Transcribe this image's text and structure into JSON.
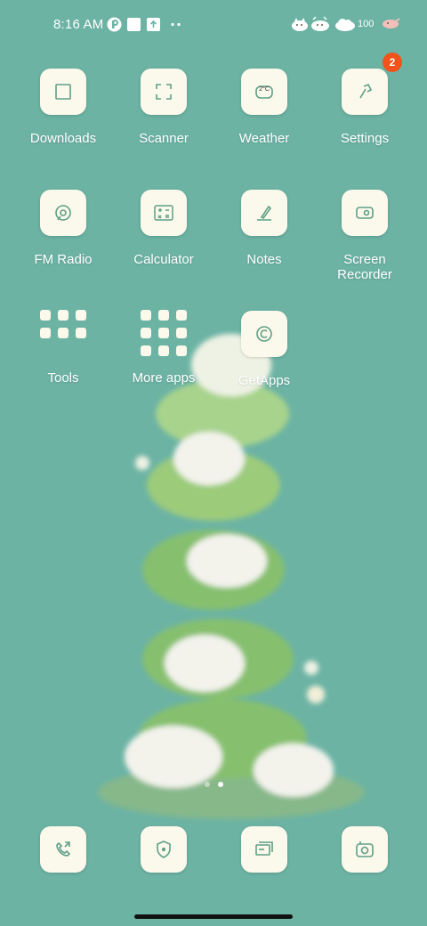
{
  "status_bar": {
    "time": "8:16 AM",
    "battery_level": "100",
    "left_icons": [
      "notification-p-icon",
      "square-app-icon",
      "upload-icon",
      "more-dots-icon"
    ],
    "right_icons": [
      "cat-cloud-icon",
      "cat-cloud-icon",
      "cloud-icon",
      "battery-cat-icon"
    ]
  },
  "apps": [
    {
      "label": "Downloads",
      "icon": "downloads-icon"
    },
    {
      "label": "Scanner",
      "icon": "scanner-icon"
    },
    {
      "label": "Weather",
      "icon": "weather-icon",
      "icon_text": "2°C"
    },
    {
      "label": "Settings",
      "icon": "settings-icon",
      "badge": "2"
    },
    {
      "label": "FM Radio",
      "icon": "fm-radio-icon"
    },
    {
      "label": "Calculator",
      "icon": "calculator-icon"
    },
    {
      "label": "Notes",
      "icon": "notes-icon"
    },
    {
      "label": "Screen Recorder",
      "icon": "screen-recorder-icon"
    },
    {
      "label": "Tools",
      "icon": "folder-icon"
    },
    {
      "label": "More apps",
      "icon": "folder-icon"
    },
    {
      "label": "GetApps",
      "icon": "getapps-icon"
    }
  ],
  "dock": [
    {
      "icon": "phone-icon"
    },
    {
      "icon": "security-shield-icon"
    },
    {
      "icon": "messages-icon"
    },
    {
      "icon": "camera-icon"
    }
  ],
  "page_indicator": {
    "pages": 2,
    "current": 2
  },
  "colors": {
    "background": "#6cb3a4",
    "icon_bg": "#fbf9ec",
    "icon_stroke": "#5f9f86",
    "badge": "#f2531a"
  }
}
